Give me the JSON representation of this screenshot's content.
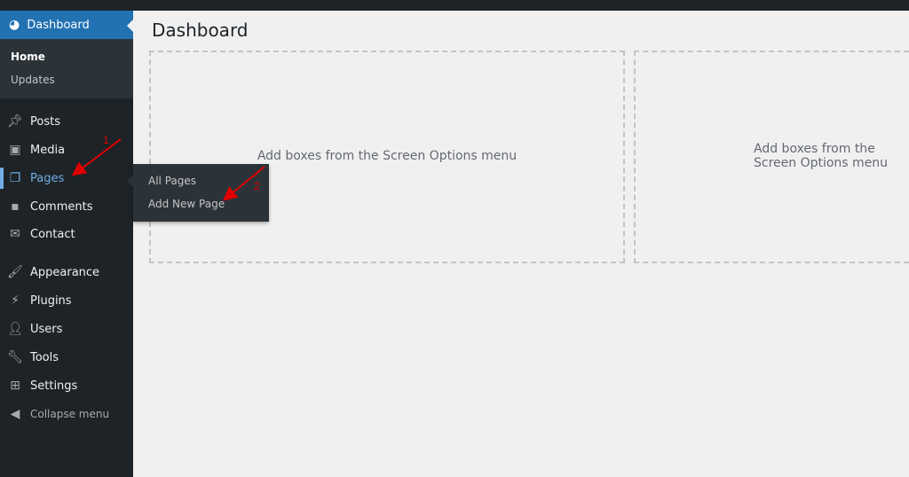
{
  "sidebar": {
    "dashboard": {
      "label": "Dashboard",
      "icon": "dashboard-gauge-icon"
    },
    "dashboard_sub": [
      "Home",
      "Updates"
    ],
    "items": [
      {
        "label": "Posts",
        "icon": "pin-icon"
      },
      {
        "label": "Media",
        "icon": "media-icon"
      },
      {
        "label": "Pages",
        "icon": "pages-icon",
        "active": true
      },
      {
        "label": "Comments",
        "icon": "comment-icon"
      },
      {
        "label": "Contact",
        "icon": "mail-icon"
      },
      {
        "label": "Appearance",
        "icon": "brush-icon"
      },
      {
        "label": "Plugins",
        "icon": "plugin-icon"
      },
      {
        "label": "Users",
        "icon": "user-icon"
      },
      {
        "label": "Tools",
        "icon": "wrench-icon"
      },
      {
        "label": "Settings",
        "icon": "settings-icon"
      }
    ],
    "collapse": "Collapse menu"
  },
  "flyout": {
    "items": [
      "All Pages",
      "Add New Page"
    ]
  },
  "main": {
    "title": "Dashboard",
    "box_text": "Add boxes from the Screen Options menu"
  },
  "annotations": {
    "step1": "1",
    "step2": "2",
    "color": "#e00000"
  },
  "colors": {
    "accent": "#2271b1",
    "sidebar": "#1d2327",
    "active_text": "#72aee6"
  }
}
